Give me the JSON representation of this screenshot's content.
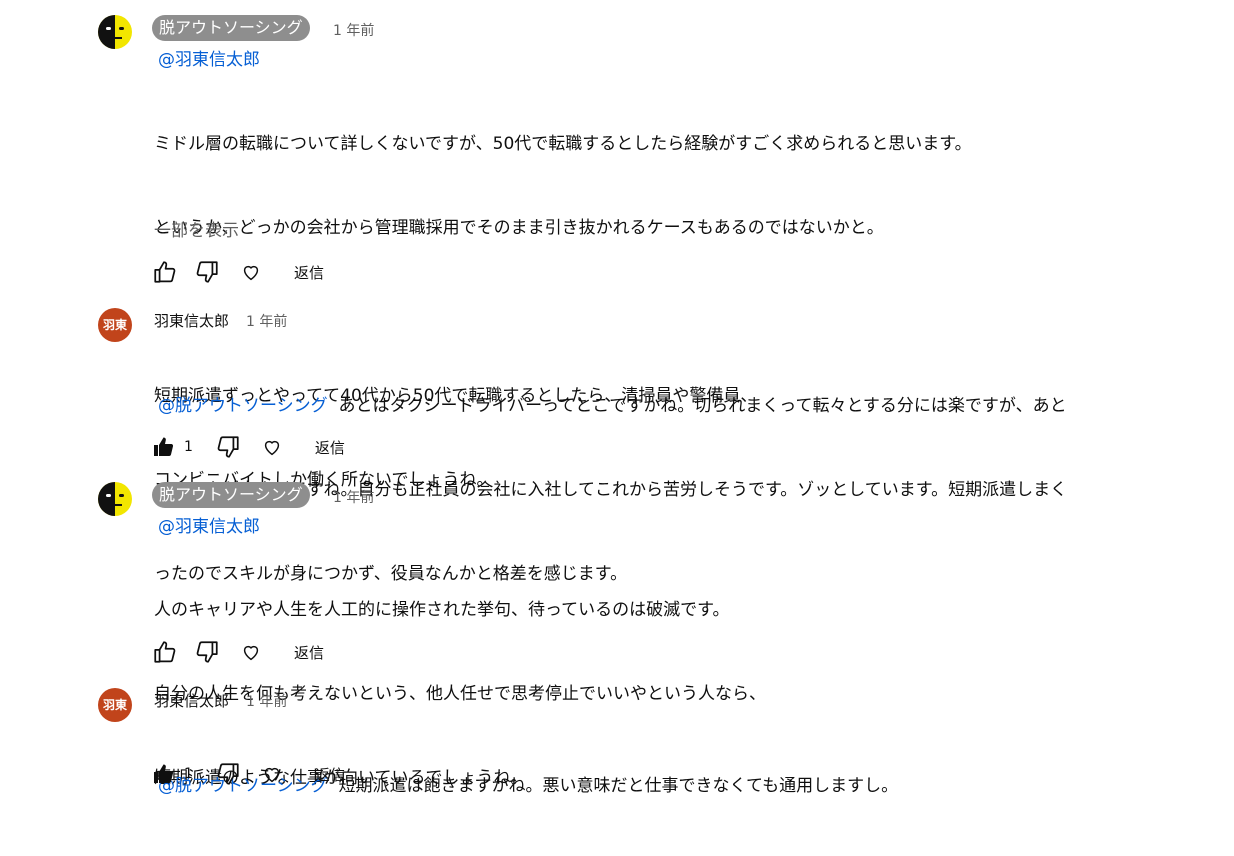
{
  "comments": [
    {
      "author": "脱アウトソーシング",
      "time": "1 年前",
      "mention": "@羽東信太郎",
      "lines": [
        "ミドル層の転職について詳しくないですが、50代で転職するとしたら経験がすごく求められると思います。",
        "というか、どっかの会社から管理職採用でそのまま引き抜かれるケースもあるのではないかと。",
        "",
        "短期派遣ずっとやってて40代から50代で転職するとしたら、清掃員や警備員、",
        "コンビニバイトしか働く所ないでしょうね。"
      ],
      "readmore": "一部を表示",
      "like_count": "",
      "reply": "返信"
    },
    {
      "author": "羽東信太郎",
      "avatar_text": "羽東",
      "time": "1 年前",
      "mention": "@脱アウトソーシング",
      "lines": [
        "あとはタクシードライバーってとこですかね。切られまくって転々とする分には楽ですが、あと",
        "のリスクが大きいですね。自分も正社員の会社に入社してこれから苦労しそうです。ゾッとしています。短期派遣しまく",
        "ったのでスキルが身につかず、役員なんかと格差を感じます。"
      ],
      "like_count": "1",
      "reply": "返信"
    },
    {
      "author": "脱アウトソーシング",
      "time": "1 年前",
      "mention": "@羽東信太郎",
      "lines": [
        "人のキャリアや人生を人工的に操作された挙句、待っているのは破滅です。",
        "自分の人生を何も考えないという、他人任せで思考停止でいいやという人なら、",
        "短期派遣のような仕事が向いているでしょうね。"
      ],
      "like_count": "",
      "reply": "返信"
    },
    {
      "author": "羽東信太郎",
      "avatar_text": "羽東",
      "time": "1 年前",
      "mention": "@脱アウトソーシング",
      "lines": [
        "短期派遣は飽きますかね。悪い意味だと仕事できなくても通用しますし。"
      ],
      "like_count": "1",
      "reply": "返信"
    }
  ]
}
